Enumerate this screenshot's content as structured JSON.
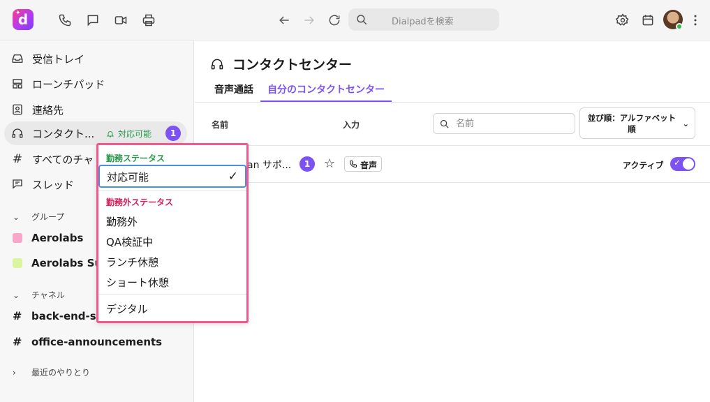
{
  "topbar": {
    "logo_letter": "d",
    "search_placeholder": "Dialpadを検索",
    "icons": [
      "phone-icon",
      "chat-icon",
      "video-icon",
      "printer-icon",
      "back-arrow-icon",
      "forward-arrow-icon",
      "refresh-icon",
      "search-icon",
      "settings-icon",
      "calendar-icon",
      "more-icon"
    ]
  },
  "sidebar": {
    "items": [
      {
        "label": "受信トレイ",
        "icon": "inbox-icon"
      },
      {
        "label": "ローンチパッド",
        "icon": "launchpad-icon"
      },
      {
        "label": "連絡先",
        "icon": "contacts-icon"
      },
      {
        "label": "コンタクト...",
        "icon": "headset-icon",
        "status": "対応可能",
        "badge": "1"
      },
      {
        "label": "すべてのチャ",
        "icon": "hash-icon"
      },
      {
        "label": "スレッド",
        "icon": "thread-icon"
      }
    ],
    "groups_heading": "グループ",
    "groups": [
      {
        "label": "Aerolabs",
        "color": "#f7a8c8"
      },
      {
        "label": "Aerolabs Sup",
        "color": "#d9f5a0"
      }
    ],
    "channels_heading": "チャネル",
    "channels": [
      {
        "label": "back-end-su"
      },
      {
        "label": "office-announcements"
      }
    ],
    "recent_heading": "最近のやりとり"
  },
  "main": {
    "title": "コンタクトセンター",
    "tabs": [
      {
        "label": "音声通話"
      },
      {
        "label": "自分のコンタクトセンター"
      }
    ],
    "columns": {
      "name": "名前",
      "input": "入力"
    },
    "name_filter_placeholder": "名前",
    "sort_label": "並び順：アルファベット順",
    "row": {
      "name": "an サポ...",
      "badge": "1",
      "channel_tag": "音声",
      "active_label": "アクティブ"
    }
  },
  "status_dropdown": {
    "working_heading": "勤務ステータス",
    "working_items": [
      "対応可能"
    ],
    "off_heading": "勤務外ステータス",
    "off_items": [
      "勤務外",
      "QA検証中",
      "ランチ休憩",
      "ショート休憩"
    ],
    "other_items": [
      "デジタル"
    ]
  },
  "colors": {
    "accent": "#7c52f5",
    "available_green": "#2a9a4a",
    "off_duty_red": "#d4215a",
    "highlight_border": "#f2588c"
  }
}
